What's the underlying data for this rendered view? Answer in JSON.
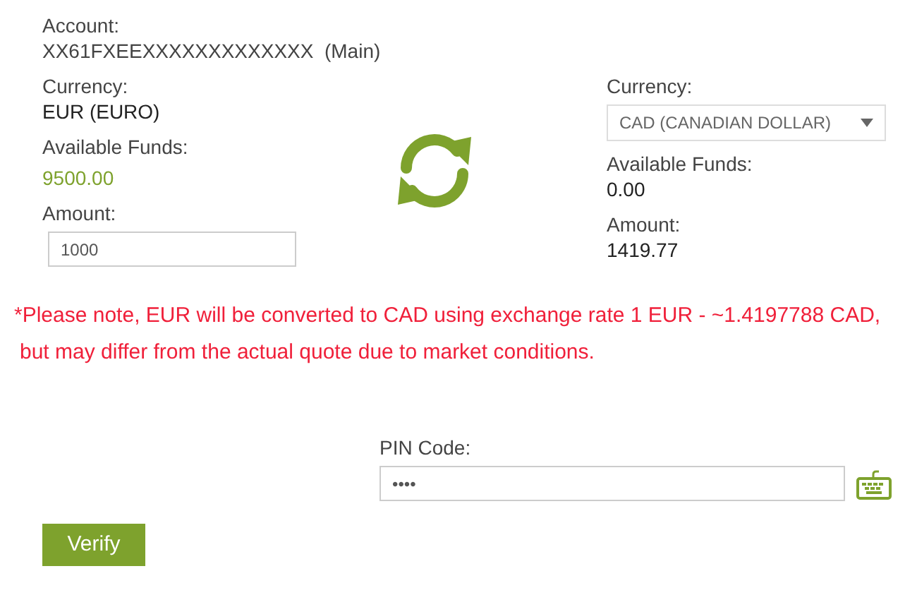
{
  "account": {
    "label": "Account:",
    "number": "XX61FXEEXXXXXXXXXXXXX",
    "tag": "(Main)"
  },
  "from": {
    "currency_label": "Currency:",
    "currency": "EUR (EURO)",
    "funds_label": "Available Funds:",
    "funds": "9500.00",
    "amount_label": "Amount:",
    "amount": "1000"
  },
  "to": {
    "currency_label": "Currency:",
    "currency": "CAD (CANADIAN DOLLAR)",
    "funds_label": "Available Funds:",
    "funds": "0.00",
    "amount_label": "Amount:",
    "amount": "1419.77"
  },
  "note": [
    "*Please note, EUR will be converted to CAD using exchange rate 1 EUR - ~1.4197788 CAD,",
    "but may differ from the actual quote due to market conditions."
  ],
  "pin": {
    "label": "PIN Code:",
    "value": "••••"
  },
  "verify_button": "Verify"
}
